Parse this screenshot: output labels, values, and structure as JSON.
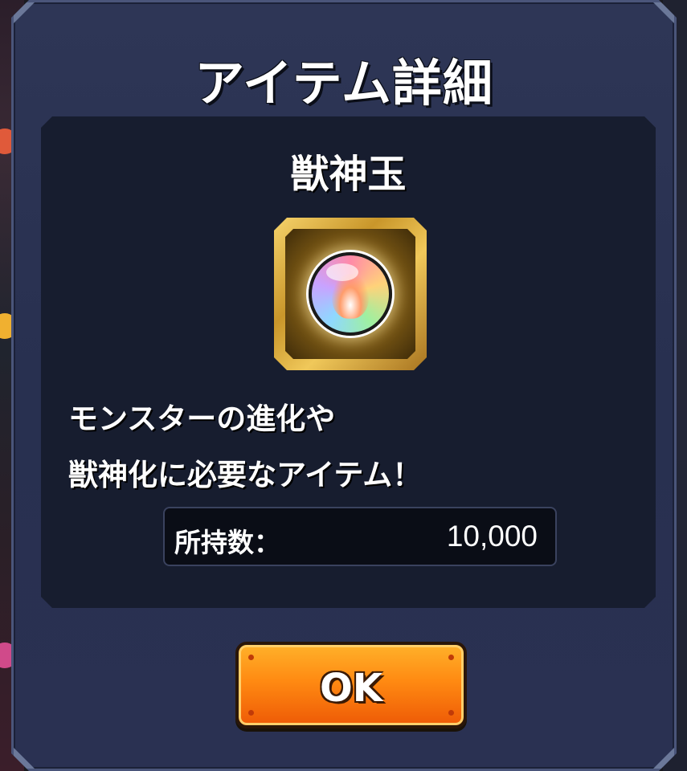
{
  "dialog": {
    "title": "アイテム詳細",
    "item": {
      "name": "獣神玉",
      "icon": "rainbow-orb-icon",
      "description_line1": "モンスターの進化や",
      "description_line2": "獣神化に必要なアイテム！",
      "count_label": "所持数：",
      "count_value": "10,000"
    },
    "ok_label": "OK"
  },
  "colors": {
    "dialog_bg": "#2a3152",
    "panel_bg": "#171d2f",
    "button_orange": "#ff8a12",
    "frame_gold": "#c9962a"
  }
}
